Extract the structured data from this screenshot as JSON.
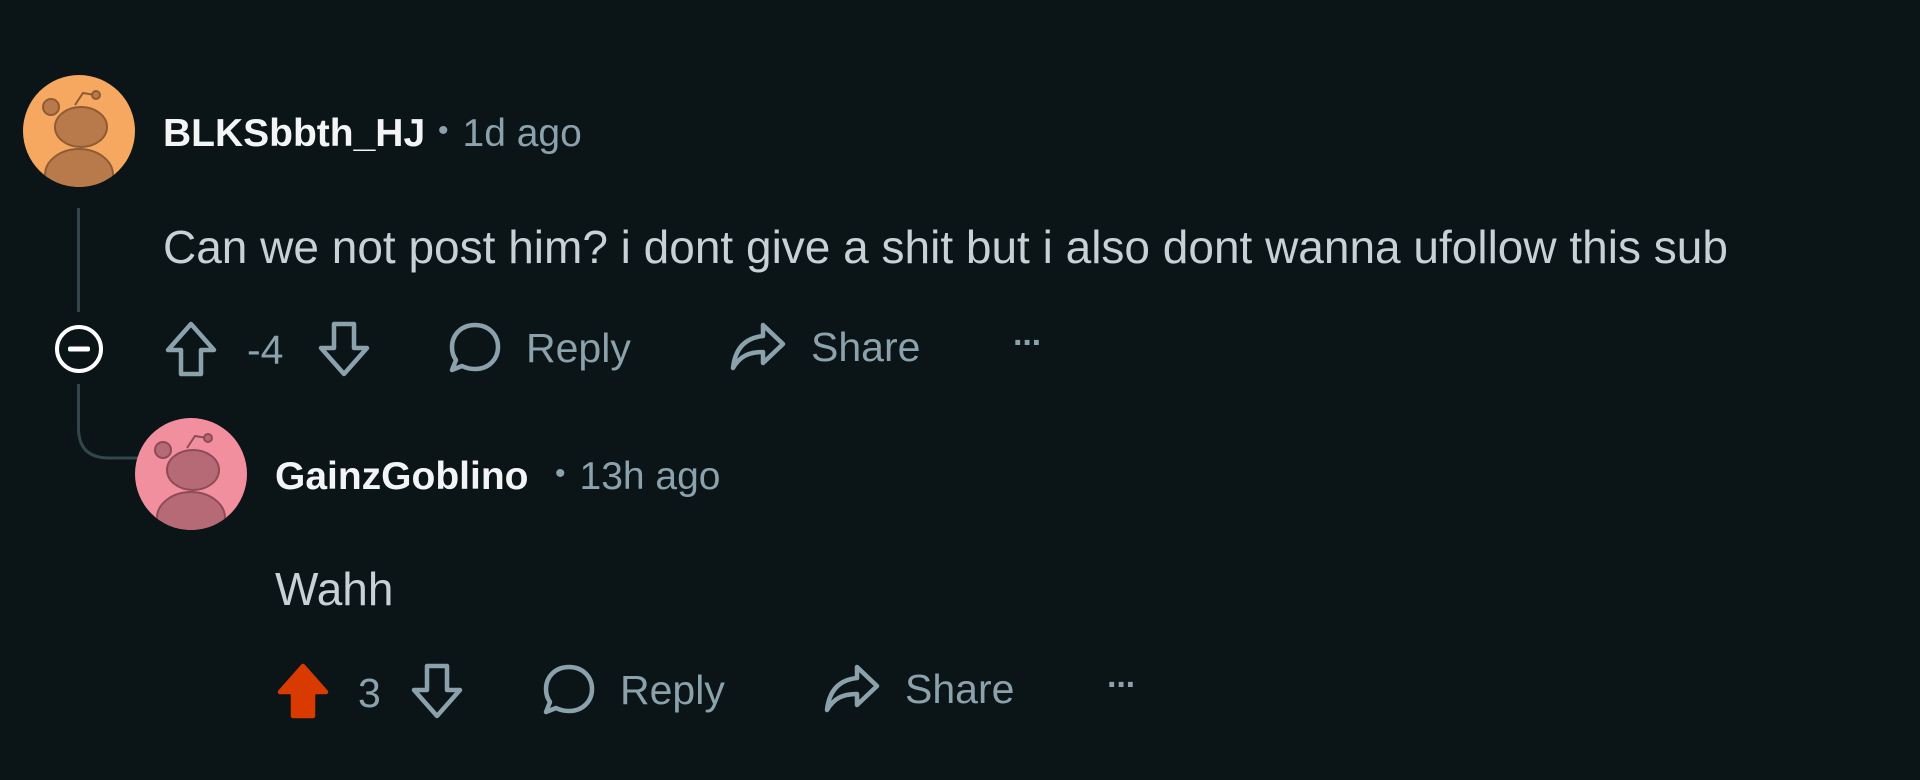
{
  "comments": [
    {
      "username": "BLKSbbth_HJ",
      "time": "1d ago",
      "text": "Can we not post him? i dont give a shit but i also dont wanna ufollow this sub",
      "score": "-4",
      "vote_state": "none",
      "avatar_color": "#f6a860",
      "reply_label": "Reply",
      "share_label": "Share",
      "more_label": "···"
    },
    {
      "username": "GainzGoblino",
      "time": "13h ago",
      "text": "Wahh",
      "score": "3",
      "vote_state": "upvoted",
      "avatar_color": "#f28f9f",
      "reply_label": "Reply",
      "share_label": "Share",
      "more_label": "···"
    }
  ],
  "separator": "•",
  "colors": {
    "background": "#0b1416",
    "upvote_active": "#d93a00",
    "muted": "#8ba2ad"
  },
  "icons": {
    "collapse": "collapse-minus-icon",
    "upvote": "arrow-up-icon",
    "downvote": "arrow-down-icon",
    "reply": "speech-bubble-icon",
    "share": "share-arrow-icon",
    "more": "ellipsis-icon"
  }
}
